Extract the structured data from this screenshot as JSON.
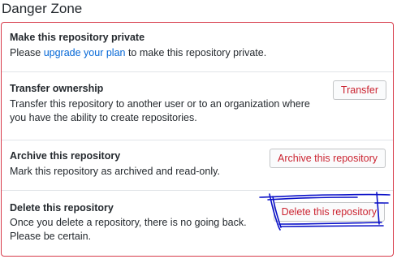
{
  "section": {
    "title": "Danger Zone"
  },
  "rows": [
    {
      "heading": "Make this repository private",
      "desc_prefix": "Please ",
      "desc_link": "upgrade your plan",
      "desc_suffix": " to make this repository private."
    },
    {
      "heading": "Transfer ownership",
      "desc": "Transfer this repository to another user or to an organization where you have the ability to create repositories.",
      "button": "Transfer"
    },
    {
      "heading": "Archive this repository",
      "desc": "Mark this repository as archived and read-only.",
      "button": "Archive this repository"
    },
    {
      "heading": "Delete this repository",
      "desc": "Once you delete a repository, there is no going back. Please be certain.",
      "button": "Delete this repository"
    }
  ],
  "colors": {
    "danger_border": "#d73a49",
    "danger_text": "#cb2431",
    "link": "#0366d6",
    "annotation": "#0a10c8"
  }
}
